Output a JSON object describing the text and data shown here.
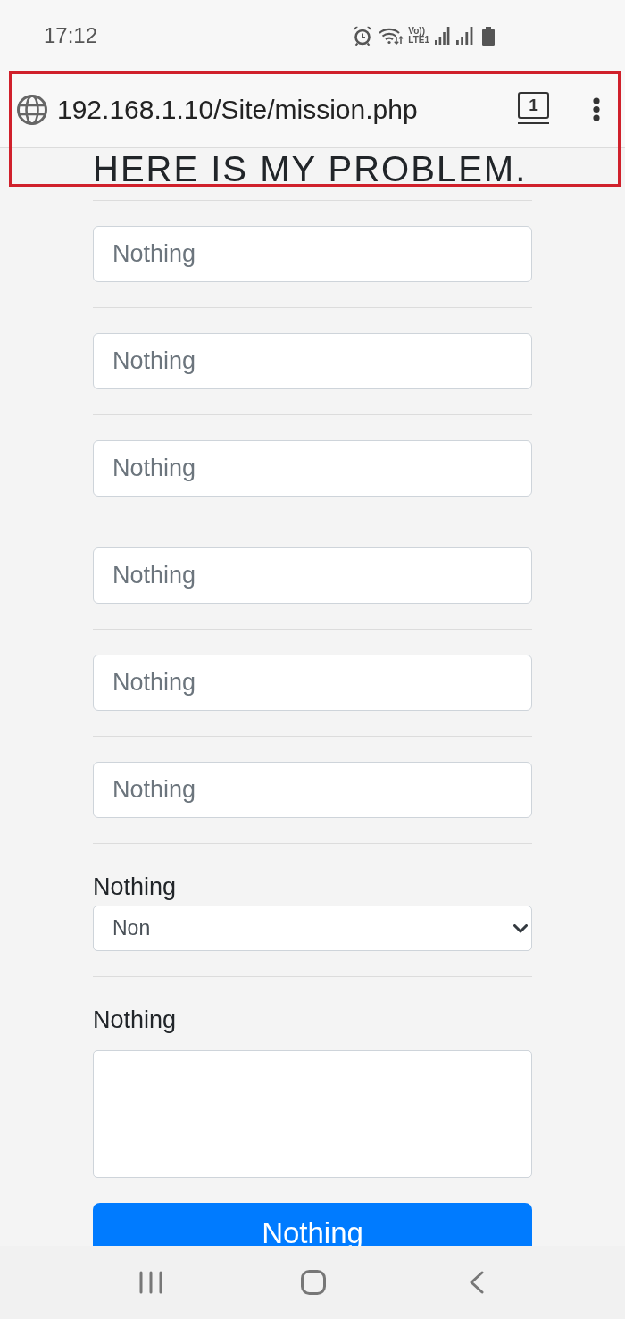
{
  "status_bar": {
    "time": "17:12",
    "network_label": [
      "Vo))",
      "LTE1"
    ]
  },
  "address_bar": {
    "url": "192.168.1.10/Site/mission.php",
    "tab_count": "1",
    "highlighted": true
  },
  "form": {
    "heading": "HERE IS MY PROBLEM.",
    "fields": [
      {
        "kind": "input",
        "placeholder": "Nothing"
      },
      {
        "kind": "input",
        "placeholder": "Nothing"
      },
      {
        "kind": "input",
        "placeholder": "Nothing"
      },
      {
        "kind": "input",
        "placeholder": "Nothing"
      },
      {
        "kind": "input",
        "placeholder": "Nothing"
      },
      {
        "kind": "input",
        "placeholder": "Nothing"
      },
      {
        "kind": "select",
        "label": "Nothing",
        "value": "Non"
      },
      {
        "kind": "textarea",
        "label": "Nothing"
      }
    ],
    "submit_button": "Nothing"
  }
}
